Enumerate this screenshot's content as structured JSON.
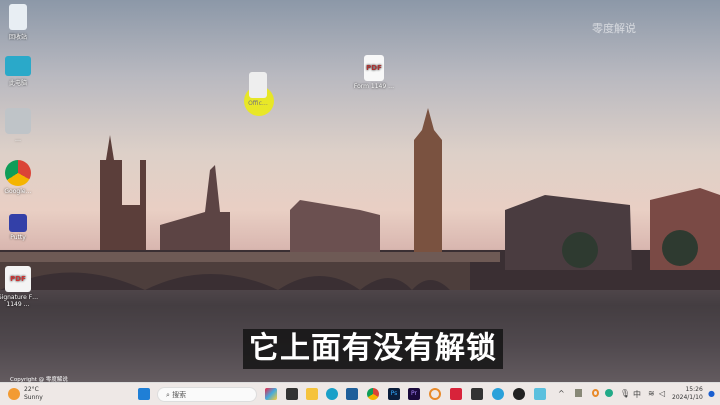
{
  "desktop": {
    "icons": [
      {
        "label": "回收站",
        "icon": "recycle-bin-icon"
      },
      {
        "label": "此电脑",
        "icon": "monitor-icon"
      },
      {
        "label": "…",
        "icon": "lock-shortcut-icon"
      },
      {
        "label": "Google…",
        "icon": "chrome-icon"
      },
      {
        "label": "Putty",
        "icon": "putty-icon"
      },
      {
        "label": "Signature F… 1149 …",
        "icon": "pdf-icon"
      },
      {
        "label": "Offic…",
        "icon": "file-icon"
      },
      {
        "label": "Form 1149 …",
        "icon": "pdf-icon"
      }
    ],
    "pdf_badge": "PDF"
  },
  "watermark": "零度解说",
  "subtitle": "它上面有没有解锁",
  "copyright": "Copyright @ 零度解说",
  "taskbar": {
    "weather": {
      "temp": "22°C",
      "condition": "Sunny"
    },
    "search_placeholder": "搜索",
    "apps": [
      "start",
      "search",
      "copilot",
      "terminal",
      "file-explorer",
      "edge",
      "store",
      "chrome",
      "photoshop",
      "premiere",
      "search-app",
      "notes",
      "sticky",
      "telegram",
      "app",
      "notepad"
    ],
    "ps": "Ps",
    "pr": "Pr",
    "tray": {
      "chevron": "^",
      "ime": "中"
    },
    "time": "15:26",
    "date": "2024/1/10"
  }
}
